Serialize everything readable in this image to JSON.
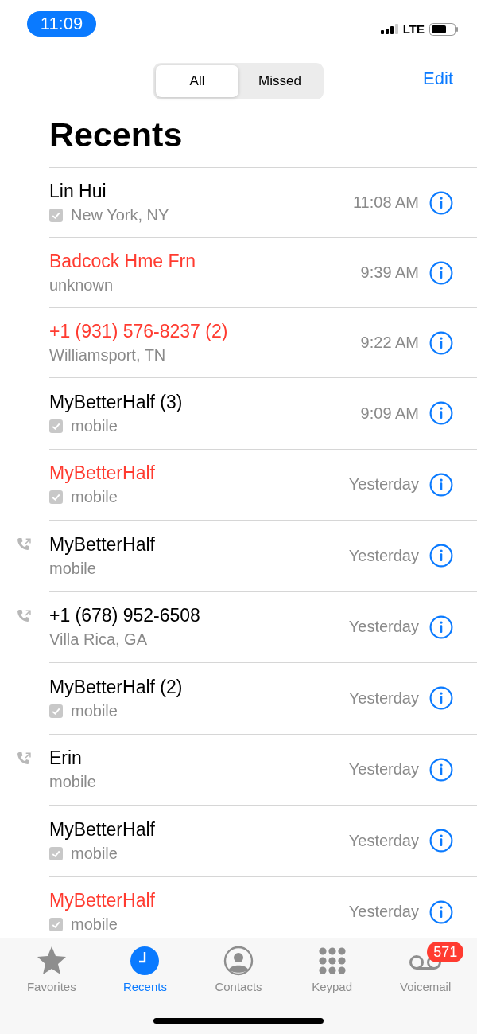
{
  "status_bar": {
    "time": "11:09",
    "network": "LTE"
  },
  "segments": [
    {
      "label": "All",
      "selected": true
    },
    {
      "label": "Missed",
      "selected": false
    }
  ],
  "edit_button": "Edit",
  "title": "Recents",
  "calls": [
    {
      "name": "Lin Hui",
      "detail": "New York, NY",
      "time": "11:08 AM",
      "missed": false,
      "outgoing": false,
      "verified": true
    },
    {
      "name": "Badcock Hme Frn",
      "detail": "unknown",
      "time": "9:39 AM",
      "missed": true,
      "outgoing": false,
      "verified": false
    },
    {
      "name": "+1 (931) 576-8237 (2)",
      "detail": "Williamsport, TN",
      "time": "9:22 AM",
      "missed": true,
      "outgoing": false,
      "verified": false
    },
    {
      "name": "MyBetterHalf (3)",
      "detail": "mobile",
      "time": "9:09 AM",
      "missed": false,
      "outgoing": false,
      "verified": true
    },
    {
      "name": "MyBetterHalf",
      "detail": "mobile",
      "time": "Yesterday",
      "missed": true,
      "outgoing": false,
      "verified": true
    },
    {
      "name": "MyBetterHalf",
      "detail": "mobile",
      "time": "Yesterday",
      "missed": false,
      "outgoing": true,
      "verified": false
    },
    {
      "name": "+1 (678) 952-6508",
      "detail": "Villa Rica, GA",
      "time": "Yesterday",
      "missed": false,
      "outgoing": true,
      "verified": false
    },
    {
      "name": "MyBetterHalf (2)",
      "detail": "mobile",
      "time": "Yesterday",
      "missed": false,
      "outgoing": false,
      "verified": true
    },
    {
      "name": "Erin",
      "detail": "mobile",
      "time": "Yesterday",
      "missed": false,
      "outgoing": true,
      "verified": false
    },
    {
      "name": "MyBetterHalf",
      "detail": "mobile",
      "time": "Yesterday",
      "missed": false,
      "outgoing": false,
      "verified": true
    },
    {
      "name": "MyBetterHalf",
      "detail": "mobile",
      "time": "Yesterday",
      "missed": true,
      "outgoing": false,
      "verified": true
    }
  ],
  "tab_bar": [
    {
      "kind": "star",
      "label": "Favorites",
      "selected": false
    },
    {
      "kind": "clock",
      "label": "Recents",
      "selected": true
    },
    {
      "kind": "person",
      "label": "Contacts",
      "selected": false
    },
    {
      "kind": "keypad",
      "label": "Keypad",
      "selected": false
    },
    {
      "kind": "voicemail",
      "label": "Voicemail",
      "selected": false,
      "badge": "571"
    }
  ]
}
